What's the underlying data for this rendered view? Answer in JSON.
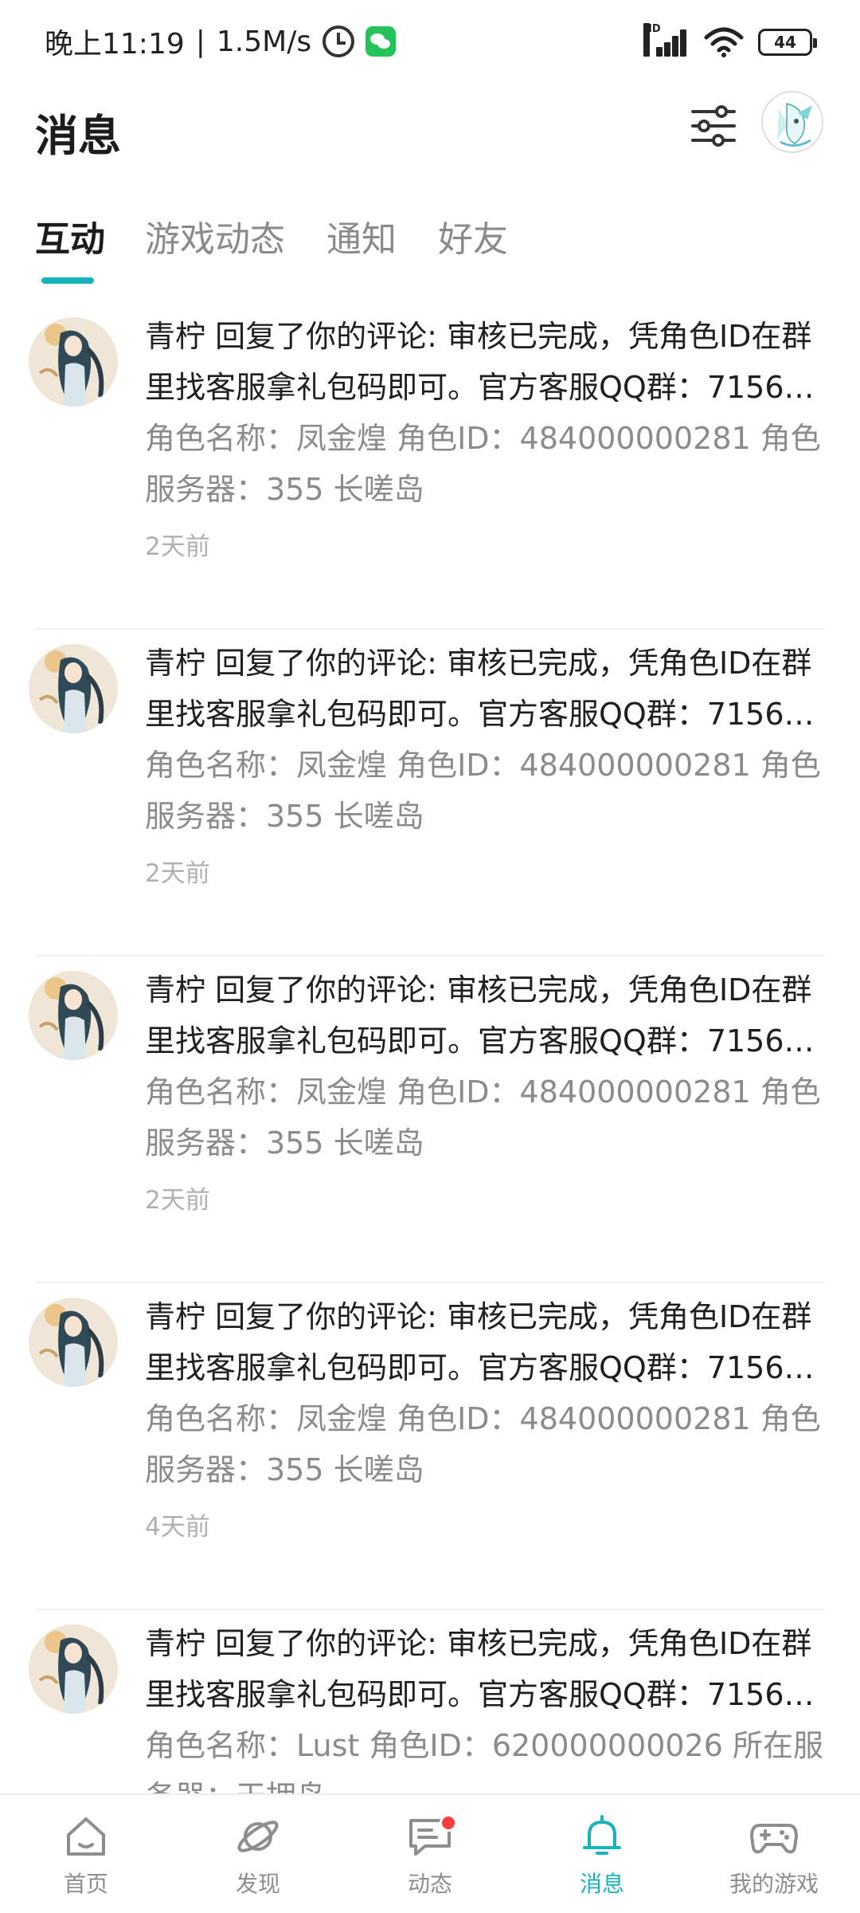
{
  "status_bar": {
    "time": "晚上11:19",
    "separator": "|",
    "net_speed": "1.5M/s",
    "hd_label": "HD",
    "battery": "44"
  },
  "header": {
    "title": "消息"
  },
  "tabs": [
    {
      "label": "互动",
      "active": true
    },
    {
      "label": "游戏动态",
      "active": false
    },
    {
      "label": "通知",
      "active": false
    },
    {
      "label": "好友",
      "active": false
    }
  ],
  "messages": [
    {
      "line1": "青柠 回复了你的评论: 审核已完成，凭角色ID在群",
      "line2": "里找客服拿礼包码即可。官方客服QQ群：7156…",
      "line3": "角色名称：凤金煌 角色ID：484000000281 角色",
      "line4": "服务器：355 长嗟岛",
      "time": "2天前"
    },
    {
      "line1": "青柠 回复了你的评论: 审核已完成，凭角色ID在群",
      "line2": "里找客服拿礼包码即可。官方客服QQ群：7156…",
      "line3": "角色名称：凤金煌 角色ID：484000000281 角色",
      "line4": "服务器：355 长嗟岛",
      "time": "2天前"
    },
    {
      "line1": "青柠 回复了你的评论: 审核已完成，凭角色ID在群",
      "line2": "里找客服拿礼包码即可。官方客服QQ群：7156…",
      "line3": "角色名称：凤金煌 角色ID：484000000281 角色",
      "line4": "服务器：355 长嗟岛",
      "time": "2天前"
    },
    {
      "line1": "青柠 回复了你的评论: 审核已完成，凭角色ID在群",
      "line2": "里找客服拿礼包码即可。官方客服QQ群：7156…",
      "line3": "角色名称：凤金煌 角色ID：484000000281 角色",
      "line4": "服务器：355 长嗟岛",
      "time": "4天前"
    },
    {
      "line1": "青柠 回复了你的评论: 审核已完成，凭角色ID在群",
      "line2": "里找客服拿礼包码即可。官方客服QQ群：7156…",
      "line3": "角色名称：Lust 角色ID：620000000026 所在服",
      "line4": "务器：天拥岛",
      "time": ""
    }
  ],
  "bottom_nav": [
    {
      "label": "首页",
      "icon": "home-icon",
      "active": false
    },
    {
      "label": "发现",
      "icon": "planet-icon",
      "active": false
    },
    {
      "label": "动态",
      "icon": "chat-bubble-icon",
      "active": false,
      "badge": true
    },
    {
      "label": "消息",
      "icon": "bell-icon",
      "active": true
    },
    {
      "label": "我的游戏",
      "icon": "gamepad-icon",
      "active": false
    }
  ],
  "colors": {
    "accent": "#19b3bd",
    "badge": "#ff3b3b",
    "text_primary": "#1f1f1f",
    "text_secondary": "#8b8b8b",
    "text_time": "#b0b0b0"
  }
}
